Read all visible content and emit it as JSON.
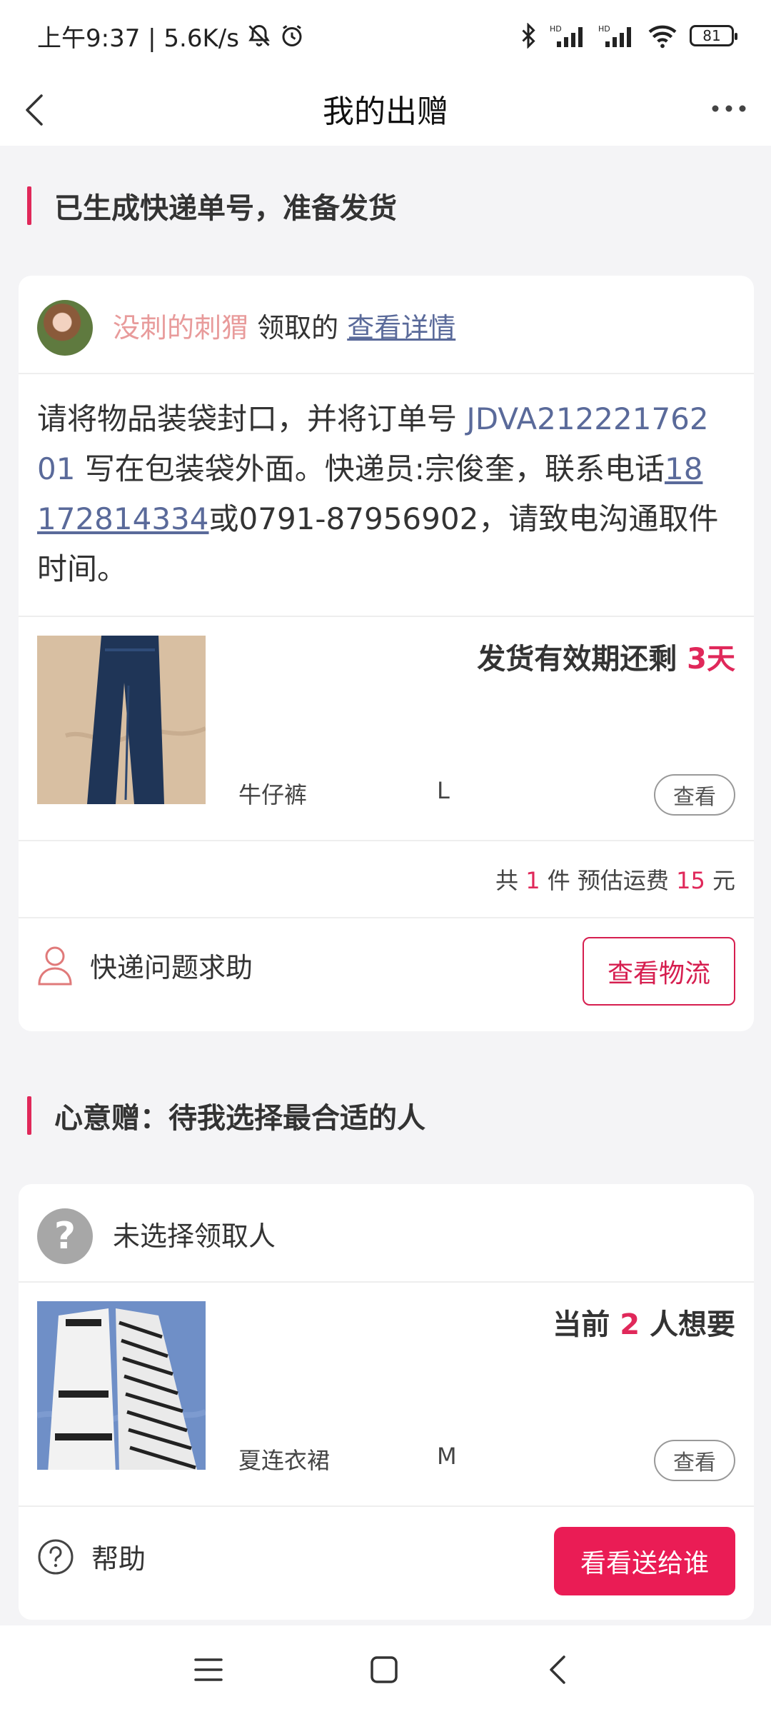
{
  "status_bar": {
    "time_speed": "上午9:37 | 5.6K/s",
    "battery": "81"
  },
  "nav": {
    "title": "我的出赠"
  },
  "section1": {
    "heading": "已生成快递单号，准备发货",
    "recipient_name": "没刺的刺猬",
    "recipient_suffix": "领取的",
    "details_link": "查看详情",
    "instruction": {
      "line1_prefix": "请将物品装袋封口，并将订单号 ",
      "line1_order": "JDVA212221762",
      "line2_order": "01",
      "line2_rest": " 写在包装袋外面。快递员:宗俊奎，联系电话",
      "line2_phone": "18",
      "line3_phone": "172814334",
      "line3_rest": "或0791-87956902，请致电沟通取件",
      "line4": "时间。"
    },
    "item": {
      "deadline_label": "发货有效期还剩",
      "deadline_value": "3天",
      "name": "牛仔裤",
      "size": "L",
      "view": "查看"
    },
    "summary": {
      "prefix": "共",
      "count": "1",
      "mid": "件 预估运费",
      "fee": "15",
      "unit": "元"
    },
    "help_label": "快递问题求助",
    "logistics_button": "查看物流"
  },
  "section2": {
    "heading": "心意赠：待我选择最合适的人",
    "no_recipient": "未选择领取人",
    "item": {
      "want_prefix": "当前",
      "want_count": "2",
      "want_suffix": "人想要",
      "name": "夏连衣裙",
      "size": "M",
      "view": "查看"
    },
    "help_label": "帮助",
    "choose_button": "看看送给谁"
  }
}
